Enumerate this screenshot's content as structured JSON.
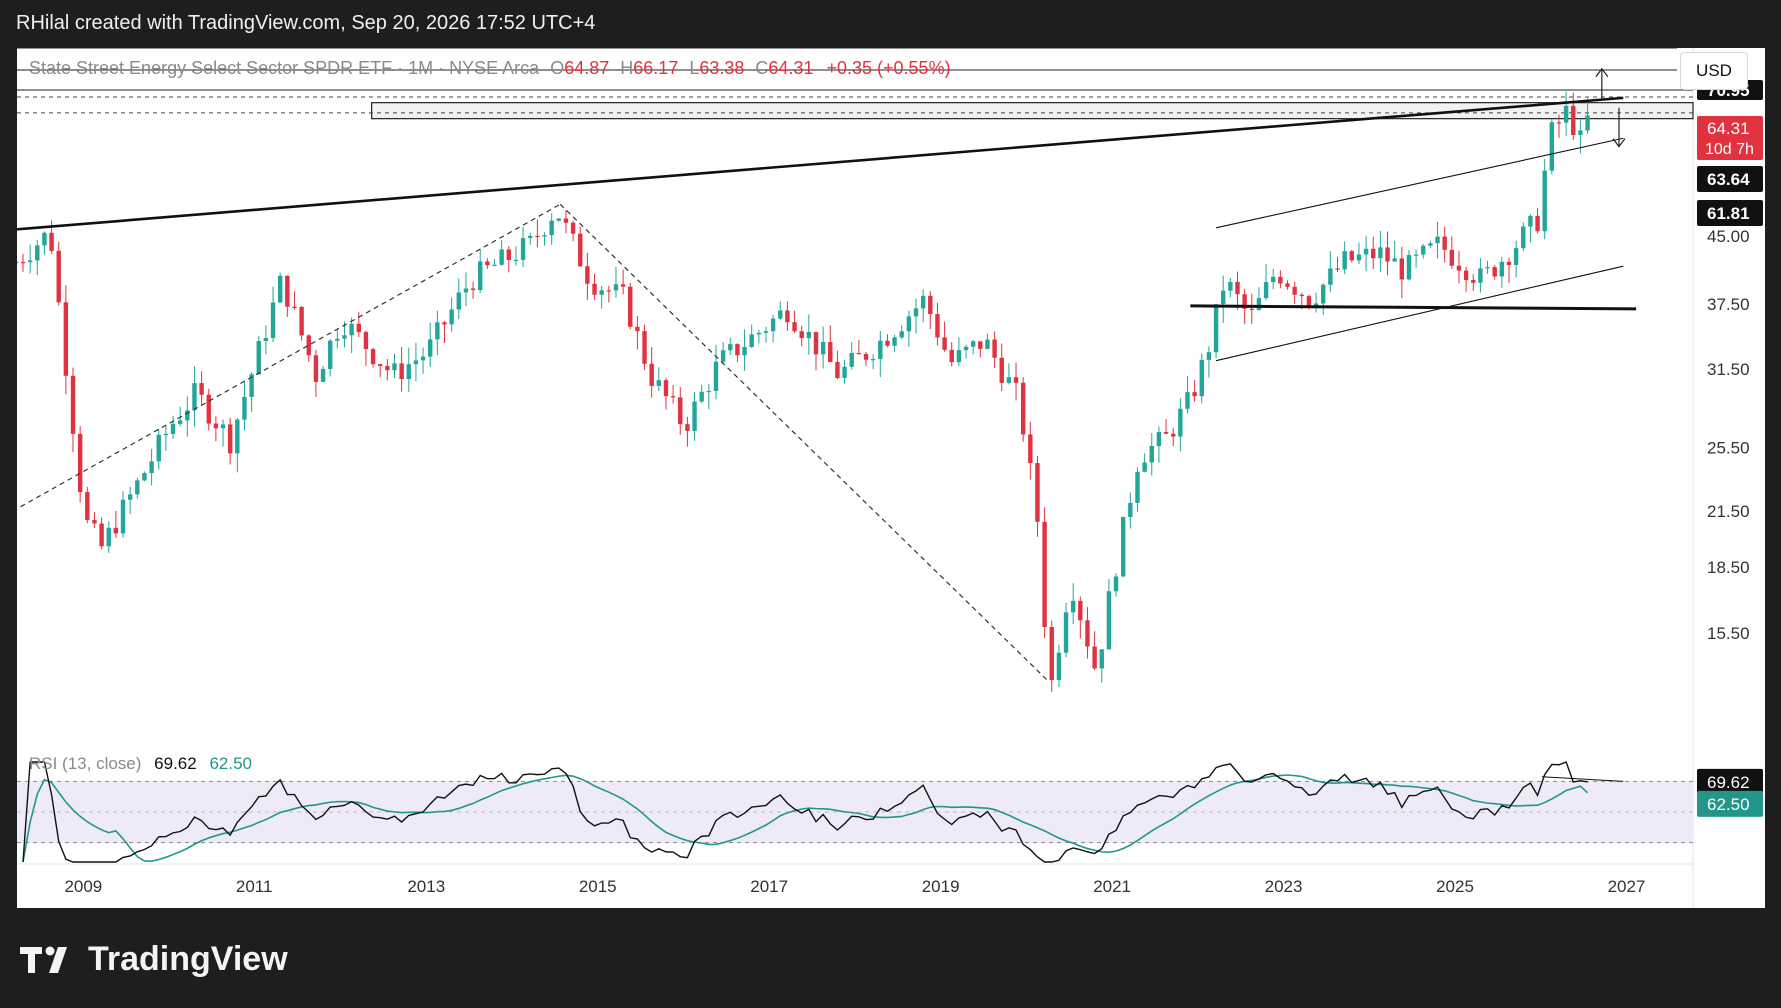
{
  "header": {
    "title": "RHilal created with TradingView.com, Sep 20, 2026 17:52 UTC+4"
  },
  "legend": {
    "symbol": "State Street Energy Select Sector SPDR ETF · 1M · NYSE Arca",
    "o_label": "O",
    "o": "64.87",
    "h_label": "H",
    "h": "66.17",
    "l_label": "L",
    "l": "63.38",
    "c_label": "C",
    "c": "64.31",
    "change": "+0.35 (+0.55%)"
  },
  "currency": "USD",
  "rsi_legend": {
    "label": "RSI (13, close)",
    "value": "69.62",
    "ma": "62.50"
  },
  "footer": {
    "brand": "TradingView"
  },
  "colors": {
    "up": "#23a69a",
    "down": "#e0323f",
    "rsi_line": "#111111",
    "rsi_ma": "#23968a",
    "rsi_bg": "#eeeaf8",
    "price_badge": "#e0323f"
  },
  "chart_data": [
    {
      "type": "candlestick",
      "scale": "log",
      "x_ticks": [
        "2009",
        "2011",
        "2013",
        "2015",
        "2017",
        "2019",
        "2021",
        "2023",
        "2025",
        "2027"
      ],
      "y_ticks": [
        "70.95",
        "45.00",
        "37.50",
        "31.50",
        "25.50",
        "21.50",
        "18.50",
        "15.50"
      ],
      "price_labels": [
        {
          "value": "70.95",
          "kind": "level"
        },
        {
          "value": "64.31",
          "kind": "last",
          "countdown": "10d 7h"
        },
        {
          "value": "63.64",
          "kind": "level"
        },
        {
          "value": "61.81",
          "kind": "level"
        }
      ],
      "ohlc_last": {
        "open": 64.87,
        "high": 66.17,
        "low": 63.38,
        "close": 64.31,
        "change": 0.35,
        "change_pct": 0.55
      },
      "annotations": [
        "Rising resistance trendline from 2008 high to 2026",
        "Dashed rising support line 2008–2014",
        "Dashed falling line 2014 high to 2020 low",
        "Grey supply zone near 61.81",
        "Ascending channel 2022–2026",
        "Horizontal support near 37.50",
        "Up arrow toward 70.95, down arrow toward 63.64"
      ],
      "keypoints": [
        [
          2008.2,
          42
        ],
        [
          2008.6,
          45.5
        ],
        [
          2009.0,
          21
        ],
        [
          2009.2,
          19.5
        ],
        [
          2010.0,
          27
        ],
        [
          2010.3,
          29.5
        ],
        [
          2010.7,
          26
        ],
        [
          2011.3,
          40
        ],
        [
          2011.7,
          31
        ],
        [
          2012.0,
          36
        ],
        [
          2012.6,
          31
        ],
        [
          2013.0,
          33
        ],
        [
          2013.5,
          40
        ],
        [
          2014.2,
          44
        ],
        [
          2014.5,
          48.5
        ],
        [
          2014.9,
          40
        ],
        [
          2015.3,
          38
        ],
        [
          2015.6,
          31
        ],
        [
          2016.0,
          27
        ],
        [
          2016.4,
          32
        ],
        [
          2016.9,
          35
        ],
        [
          2017.2,
          37
        ],
        [
          2017.8,
          31
        ],
        [
          2018.3,
          34
        ],
        [
          2018.8,
          38
        ],
        [
          2019.1,
          32
        ],
        [
          2019.5,
          34
        ],
        [
          2019.9,
          29
        ],
        [
          2020.15,
          20
        ],
        [
          2020.25,
          13
        ],
        [
          2020.5,
          18
        ],
        [
          2020.8,
          14
        ],
        [
          2021.0,
          18
        ],
        [
          2021.3,
          25
        ],
        [
          2021.6,
          26
        ],
        [
          2021.9,
          29
        ],
        [
          2022.1,
          33
        ],
        [
          2022.3,
          40
        ],
        [
          2022.6,
          36
        ],
        [
          2022.9,
          41
        ],
        [
          2023.3,
          38
        ],
        [
          2023.7,
          42
        ],
        [
          2024.1,
          43
        ],
        [
          2024.4,
          41
        ],
        [
          2024.8,
          44
        ],
        [
          2025.3,
          40
        ],
        [
          2025.7,
          44
        ],
        [
          2025.95,
          47
        ],
        [
          2026.1,
          59
        ],
        [
          2026.3,
          63
        ],
        [
          2026.45,
          58
        ],
        [
          2026.6,
          64.31
        ]
      ]
    },
    {
      "type": "line",
      "name": "RSI (13, close)",
      "last_value": 69.62,
      "ma_last_value": 62.5,
      "right_labels": [
        "69.62",
        "62.50"
      ]
    }
  ]
}
